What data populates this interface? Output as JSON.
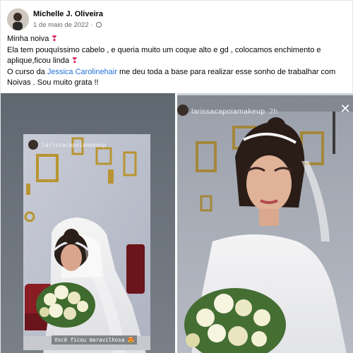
{
  "post": {
    "author": "Michelle J. Oliveira",
    "date": "1 de maio de 2022",
    "privacy_icon": "globe-icon",
    "lines": [
      "Minha noiva",
      "Ela tem pouquíssimo cabelo , e queria muito um coque alto e gd , colocamos enchimento e",
      "aplique,ficou linda"
    ],
    "line4_prefix": "O curso da ",
    "mention": "Jessica Carolinehair",
    "line4_suffix": " me deu toda a base para realizar esse sonho de trabalhar com",
    "line5": "Noivas . Sou muito grata !!",
    "heart_glyph": "❣"
  },
  "photos": {
    "left": {
      "username": "larissacapoiamakeup",
      "caption": "Você ficou maravilhosa 😍"
    },
    "right": {
      "username": "larissacapoiamakeup",
      "time": "2h",
      "close_icon": "close-icon"
    }
  },
  "colors": {
    "link": "#216fdb",
    "heart": "#e0245e",
    "meta": "#65676b"
  }
}
